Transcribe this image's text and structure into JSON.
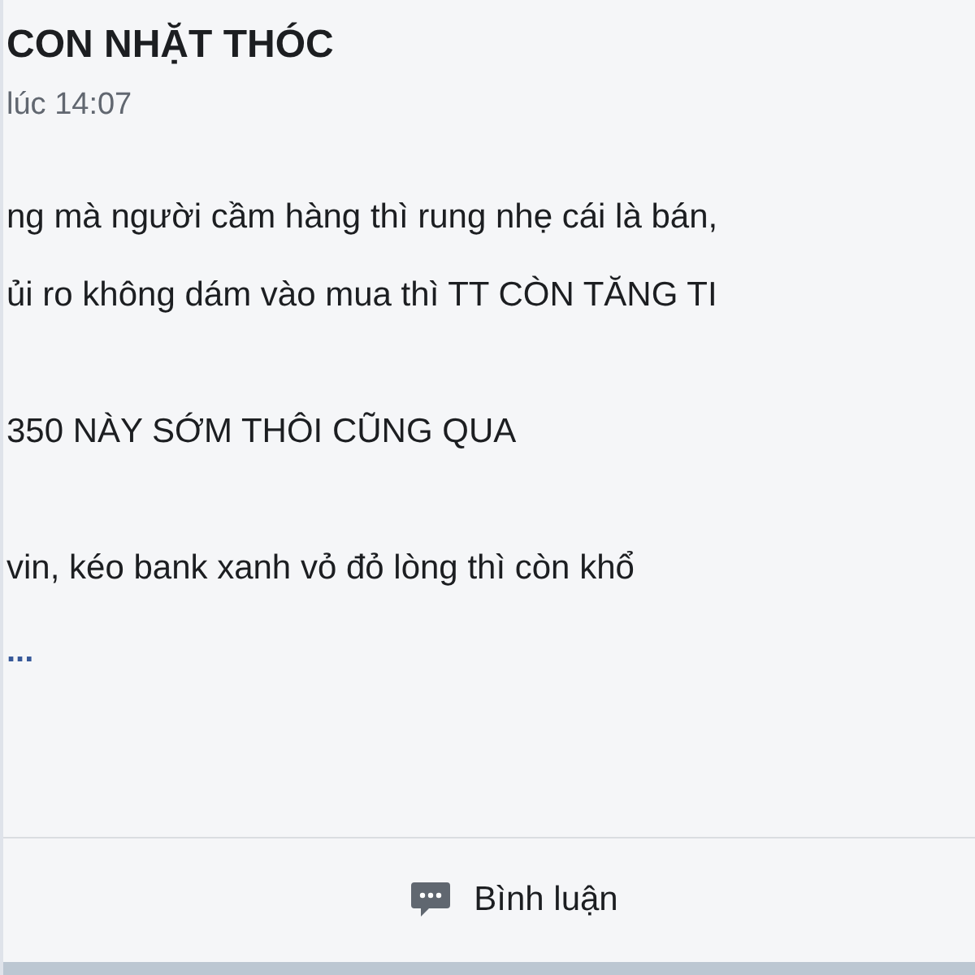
{
  "post": {
    "author": "CON NHẶT THÓC",
    "time": "lúc 14:07",
    "paragraphs": [
      [
        "ng mà người cầm hàng thì rung nhẹ cái là bán,",
        "ủi ro không dám vào mua thì TT CÒN TĂNG TI"
      ],
      [
        "350 NÀY SỚM THÔI CŨNG QUA"
      ],
      [
        "vin, kéo bank xanh vỏ đỏ lòng thì còn khổ"
      ]
    ],
    "see_more": "..."
  },
  "actions": [
    {
      "label": "Bình luận",
      "kind": "comment"
    }
  ]
}
